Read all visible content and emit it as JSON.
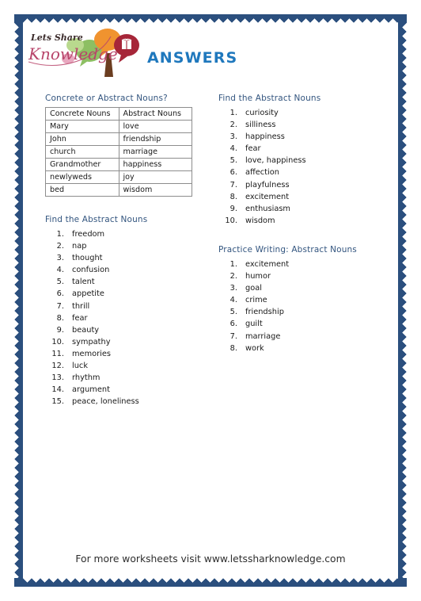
{
  "document": {
    "title": "ANSWERS",
    "logo": {
      "line1": "Lets Share",
      "line2": "Knowledge",
      "tree_icon": "tree-speech-bubble-logo-icon",
      "book_icon": "book-icon"
    },
    "colors": {
      "border": "#2b4f7e",
      "title_blue": "#1f78bd",
      "section_heading": "#33557f",
      "body_text": "#1a1a1a",
      "table_border": "#8d8d8d",
      "logo_script_dark": "#3b2b2b",
      "logo_script_pink": "#b8456b",
      "leaf_green": "#8dbf63",
      "leaf_orange": "#f0932f",
      "leaf_red": "#a62639",
      "trunk_brown": "#6b3d20"
    }
  },
  "left_column": {
    "table_section": {
      "heading": "Concrete or Abstract Nouns?",
      "columns": [
        "Concrete Nouns",
        "Abstract Nouns"
      ],
      "rows": [
        [
          "Mary",
          "love"
        ],
        [
          "John",
          "friendship"
        ],
        [
          "church",
          "marriage"
        ],
        [
          "Grandmother",
          "happiness"
        ],
        [
          "newlyweds",
          "joy"
        ],
        [
          "bed",
          "wisdom"
        ]
      ]
    },
    "list_section": {
      "heading": "Find the Abstract Nouns",
      "items": [
        "freedom",
        "nap",
        "thought",
        "confusion",
        "talent",
        "appetite",
        "thrill",
        "fear",
        "beauty",
        "sympathy",
        "memories",
        "luck",
        "rhythm",
        "argument",
        "peace, loneliness"
      ]
    }
  },
  "right_column": {
    "list_section_1": {
      "heading": "Find the Abstract Nouns",
      "items": [
        "curiosity",
        "silliness",
        "happiness",
        "fear",
        "love, happiness",
        "affection",
        "playfulness",
        "excitement",
        "enthusiasm",
        "wisdom"
      ]
    },
    "list_section_2": {
      "heading": "Practice Writing: Abstract Nouns",
      "items": [
        "excitement",
        "humor",
        "goal",
        "crime",
        "friendship",
        "guilt",
        "marriage",
        "work"
      ]
    }
  },
  "footer": {
    "text": "For more worksheets visit www.letssharknowledge.com"
  }
}
